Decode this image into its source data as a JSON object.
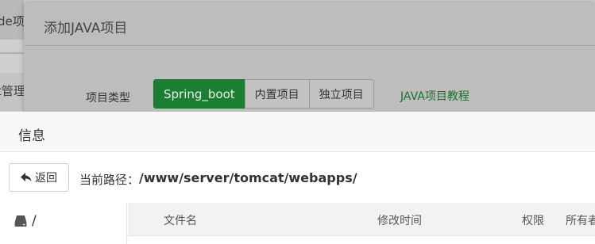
{
  "background": {
    "item1_text": "de项",
    "item2_text": "t管理"
  },
  "java_dialog": {
    "title": "添加JAVA项目",
    "project_type_label": "项目类型",
    "type_buttons": [
      "Spring_boot",
      "内置项目",
      "独立项目"
    ],
    "tutorial_link": "JAVA项目教程"
  },
  "info_dialog": {
    "title": "信息",
    "back_button": "返回",
    "path_label": "当前路径：",
    "current_path": "/www/server/tomcat/webapps/",
    "tree_root": "/",
    "columns": [
      "文件名",
      "修改时间",
      "权限",
      "所有者"
    ]
  },
  "colors": {
    "accent_green": "#1b7f32",
    "link_green": "#1a6e2c"
  },
  "icons": [
    "arrow-back-icon",
    "disk-icon"
  ]
}
